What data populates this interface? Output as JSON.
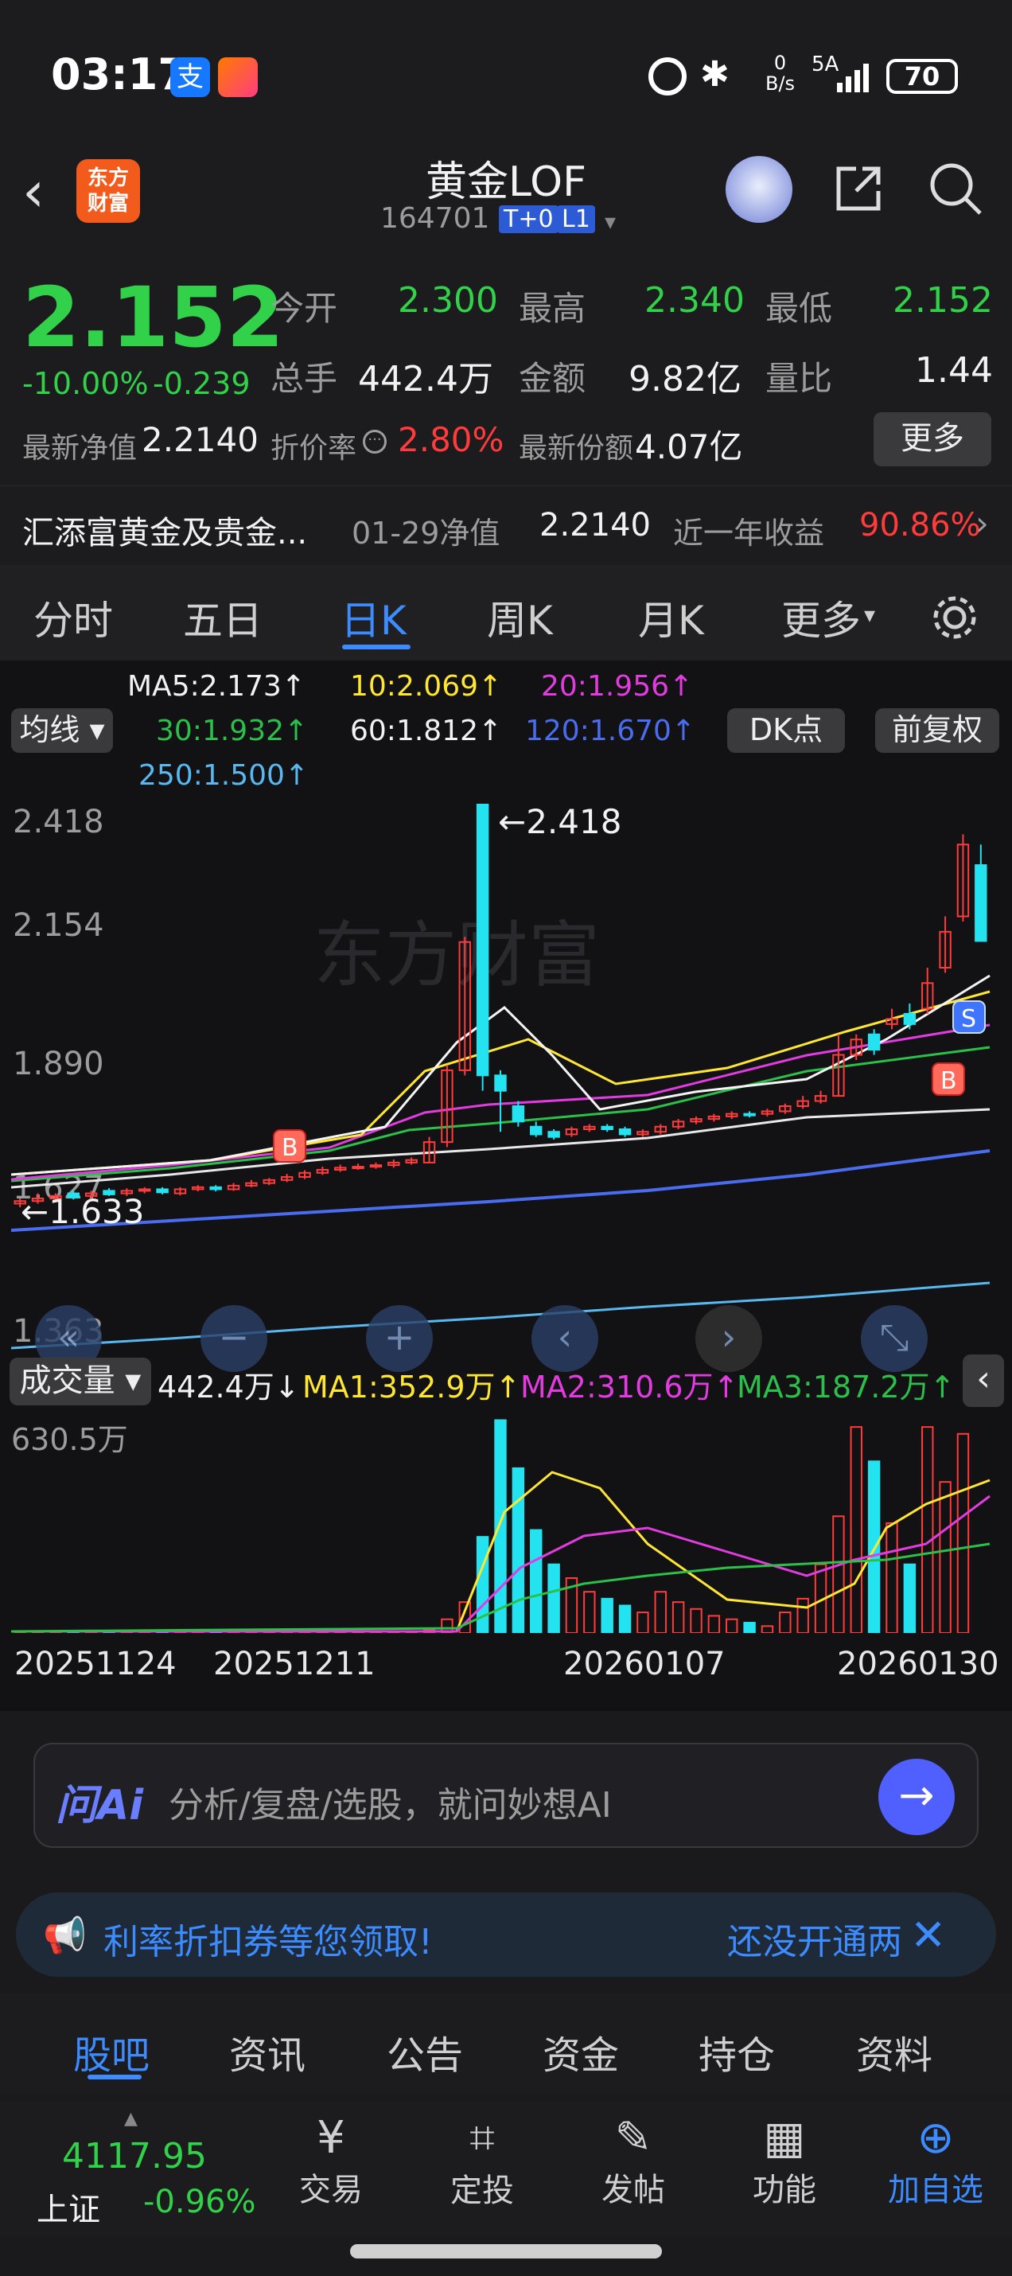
{
  "status": {
    "time": "03:17",
    "net_speed_top": "0",
    "net_speed_unit": "B/s",
    "signal": "5A",
    "battery": "70"
  },
  "header": {
    "title": "黄金LOF",
    "code": "164701",
    "badge1": "T+0",
    "badge2": "L1",
    "logo_line1": "东方",
    "logo_line2": "财富"
  },
  "quote": {
    "price": "2.152",
    "pct": "-10.00%",
    "chg": "-0.239",
    "open_label": "今开",
    "open": "2.300",
    "high_label": "最高",
    "high": "2.340",
    "low_label": "最低",
    "low": "2.152",
    "vol_label": "总手",
    "vol": "442.4万",
    "amt_label": "金额",
    "amt": "9.82亿",
    "ratio_label": "量比",
    "ratio": "1.44",
    "nav_label": "最新净值",
    "nav": "2.2140",
    "disc_label": "折价率",
    "disc": "2.80%",
    "share_label": "最新份额",
    "share": "4.07亿",
    "more": "更多"
  },
  "info": {
    "name": "汇添富黄金及贵金...",
    "date_nav": "01-29净值",
    "nav": "2.2140",
    "yr_label": "近一年收益",
    "yr_value": "90.86%"
  },
  "tabs": [
    "分时",
    "五日",
    "日K",
    "周K",
    "月K",
    "更多"
  ],
  "ma_legend": {
    "ma5": "MA5:2.173↑",
    "ma10": "10:2.069↑",
    "ma20": "20:1.956↑",
    "ma30": "30:1.932↑",
    "ma60": "60:1.812↑",
    "ma120": "120:1.670↑",
    "ma250": "250:1.500↑",
    "btn_ma": "均线",
    "btn_dk": "DK点",
    "btn_fq": "前复权"
  },
  "price_axis": {
    "top": "2.418",
    "mid1": "2.154",
    "mid2": "1.890",
    "low_mark": "1.627",
    "bottom": "1.363"
  },
  "annotations": {
    "max": "←2.418",
    "min": "←1.633"
  },
  "volume": {
    "label": "成交量",
    "value": "442.4万↓",
    "ma1": "MA1:352.9万↑",
    "ma2": "MA2:310.6万↑",
    "ma3": "MA3:187.2万↑",
    "axis_top": "630.5万"
  },
  "dates": [
    "20251124",
    "20251211",
    "20260107",
    "20260130"
  ],
  "chart_data": {
    "type": "candlestick",
    "ylim": [
      1.363,
      2.418
    ],
    "candles": [
      {
        "o": 1.64,
        "c": 1.645,
        "h": 1.65,
        "l": 1.633
      },
      {
        "o": 1.645,
        "c": 1.65,
        "h": 1.66,
        "l": 1.64
      },
      {
        "o": 1.65,
        "c": 1.655,
        "h": 1.66,
        "l": 1.645
      },
      {
        "o": 1.66,
        "c": 1.652,
        "h": 1.665,
        "l": 1.648
      },
      {
        "o": 1.655,
        "c": 1.66,
        "h": 1.665,
        "l": 1.65
      },
      {
        "o": 1.665,
        "c": 1.658,
        "h": 1.67,
        "l": 1.655
      },
      {
        "o": 1.66,
        "c": 1.665,
        "h": 1.67,
        "l": 1.655
      },
      {
        "o": 1.665,
        "c": 1.668,
        "h": 1.672,
        "l": 1.66
      },
      {
        "o": 1.668,
        "c": 1.662,
        "h": 1.672,
        "l": 1.658
      },
      {
        "o": 1.66,
        "c": 1.668,
        "h": 1.672,
        "l": 1.656
      },
      {
        "o": 1.668,
        "c": 1.672,
        "h": 1.676,
        "l": 1.664
      },
      {
        "o": 1.672,
        "c": 1.668,
        "h": 1.676,
        "l": 1.664
      },
      {
        "o": 1.668,
        "c": 1.675,
        "h": 1.68,
        "l": 1.665
      },
      {
        "o": 1.675,
        "c": 1.68,
        "h": 1.686,
        "l": 1.672
      },
      {
        "o": 1.68,
        "c": 1.686,
        "h": 1.69,
        "l": 1.676
      },
      {
        "o": 1.686,
        "c": 1.692,
        "h": 1.698,
        "l": 1.682
      },
      {
        "o": 1.692,
        "c": 1.7,
        "h": 1.705,
        "l": 1.688
      },
      {
        "o": 1.7,
        "c": 1.706,
        "h": 1.712,
        "l": 1.696
      },
      {
        "o": 1.706,
        "c": 1.71,
        "h": 1.716,
        "l": 1.702
      },
      {
        "o": 1.71,
        "c": 1.712,
        "h": 1.718,
        "l": 1.706
      },
      {
        "o": 1.712,
        "c": 1.715,
        "h": 1.72,
        "l": 1.708
      },
      {
        "o": 1.715,
        "c": 1.72,
        "h": 1.726,
        "l": 1.71
      },
      {
        "o": 1.72,
        "c": 1.725,
        "h": 1.73,
        "l": 1.716
      },
      {
        "o": 1.72,
        "c": 1.76,
        "h": 1.77,
        "l": 1.72
      },
      {
        "o": 1.76,
        "c": 1.9,
        "h": 1.91,
        "l": 1.75
      },
      {
        "o": 1.9,
        "c": 2.15,
        "h": 2.16,
        "l": 1.89
      },
      {
        "o": 2.418,
        "c": 1.89,
        "h": 2.418,
        "l": 1.86
      },
      {
        "o": 1.89,
        "c": 1.86,
        "h": 1.9,
        "l": 1.78
      },
      {
        "o": 1.83,
        "c": 1.8,
        "h": 1.84,
        "l": 1.79
      },
      {
        "o": 1.79,
        "c": 1.775,
        "h": 1.8,
        "l": 1.77
      },
      {
        "o": 1.78,
        "c": 1.77,
        "h": 1.785,
        "l": 1.765
      },
      {
        "o": 1.775,
        "c": 1.785,
        "h": 1.79,
        "l": 1.77
      },
      {
        "o": 1.785,
        "c": 1.79,
        "h": 1.795,
        "l": 1.78
      },
      {
        "o": 1.79,
        "c": 1.785,
        "h": 1.795,
        "l": 1.78
      },
      {
        "o": 1.785,
        "c": 1.775,
        "h": 1.79,
        "l": 1.77
      },
      {
        "o": 1.775,
        "c": 1.78,
        "h": 1.785,
        "l": 1.77
      },
      {
        "o": 1.78,
        "c": 1.79,
        "h": 1.795,
        "l": 1.775
      },
      {
        "o": 1.79,
        "c": 1.8,
        "h": 1.805,
        "l": 1.785
      },
      {
        "o": 1.8,
        "c": 1.805,
        "h": 1.81,
        "l": 1.795
      },
      {
        "o": 1.805,
        "c": 1.81,
        "h": 1.815,
        "l": 1.8
      },
      {
        "o": 1.81,
        "c": 1.815,
        "h": 1.82,
        "l": 1.805
      },
      {
        "o": 1.815,
        "c": 1.812,
        "h": 1.82,
        "l": 1.808
      },
      {
        "o": 1.815,
        "c": 1.82,
        "h": 1.825,
        "l": 1.81
      },
      {
        "o": 1.82,
        "c": 1.83,
        "h": 1.835,
        "l": 1.815
      },
      {
        "o": 1.83,
        "c": 1.84,
        "h": 1.85,
        "l": 1.825
      },
      {
        "o": 1.84,
        "c": 1.85,
        "h": 1.86,
        "l": 1.835
      },
      {
        "o": 1.85,
        "c": 1.93,
        "h": 1.97,
        "l": 1.85
      },
      {
        "o": 1.93,
        "c": 1.96,
        "h": 1.97,
        "l": 1.92
      },
      {
        "o": 1.97,
        "c": 1.94,
        "h": 1.98,
        "l": 1.93
      },
      {
        "o": 1.99,
        "c": 2.0,
        "h": 2.02,
        "l": 1.98
      },
      {
        "o": 2.01,
        "c": 1.99,
        "h": 2.03,
        "l": 1.98
      },
      {
        "o": 2.02,
        "c": 2.07,
        "h": 2.1,
        "l": 2.01
      },
      {
        "o": 2.1,
        "c": 2.17,
        "h": 2.2,
        "l": 2.09
      },
      {
        "o": 2.2,
        "c": 2.34,
        "h": 2.36,
        "l": 2.19
      },
      {
        "o": 2.3,
        "c": 2.152,
        "h": 2.34,
        "l": 2.152
      }
    ],
    "volume": [
      2,
      2,
      2,
      2,
      2,
      2,
      2,
      2,
      2,
      2,
      2,
      2,
      2,
      2,
      2,
      2,
      2,
      2,
      2,
      2,
      2,
      2,
      2,
      10,
      40,
      90,
      280,
      620,
      480,
      300,
      200,
      160,
      120,
      100,
      80,
      60,
      120,
      90,
      70,
      50,
      40,
      30,
      20,
      60,
      100,
      200,
      340,
      600,
      500,
      320,
      200,
      600,
      440,
      580
    ],
    "vol_ylim": [
      0,
      630.5
    ]
  },
  "ai": {
    "logo": "问Ai",
    "placeholder": "分析/复盘/选股，就问妙想AI"
  },
  "promo": {
    "text": "利率折扣券等您领取!",
    "right": "还没开通两"
  },
  "bottom_tabs": [
    "股吧",
    "资讯",
    "公告",
    "资金",
    "持仓",
    "资料"
  ],
  "index": {
    "value": "4117.95",
    "name": "上证",
    "pct": "-0.96%"
  },
  "nav": [
    "交易",
    "定投",
    "发帖",
    "功能",
    "加自选"
  ]
}
